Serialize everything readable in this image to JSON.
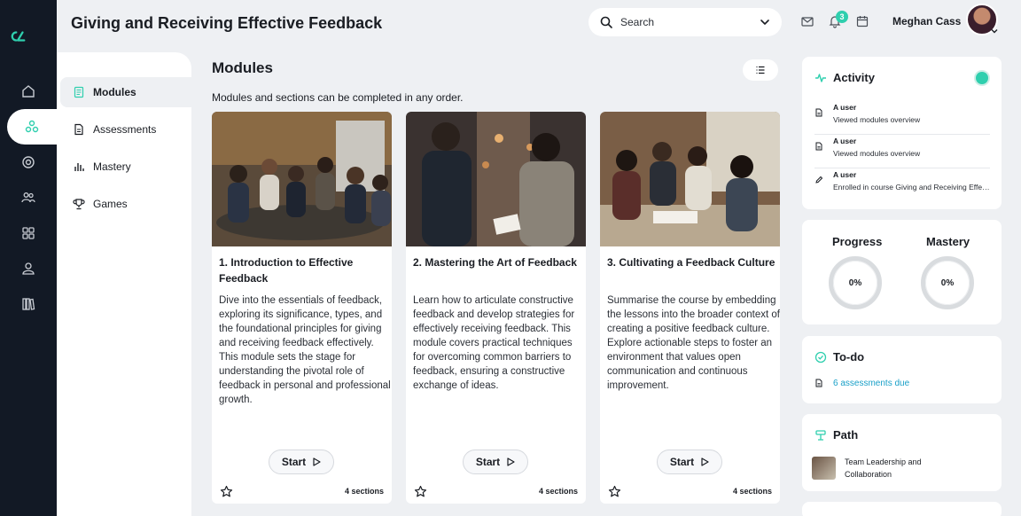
{
  "header": {
    "title": "Giving and Receiving Effective Feedback",
    "search_placeholder": "Search",
    "notifications_count": "3",
    "user_name": "Meghan Cass"
  },
  "rail": {
    "items": [
      "home-icon",
      "network-icon",
      "target-icon",
      "people-icon",
      "grid-icon",
      "user-icon",
      "library-icon"
    ],
    "active_index": 1,
    "brand_color": "#2fcfae"
  },
  "subnav": {
    "items": [
      {
        "label": "Modules",
        "icon": "book-icon"
      },
      {
        "label": "Assessments",
        "icon": "document-icon"
      },
      {
        "label": "Mastery",
        "icon": "bar-chart-icon"
      },
      {
        "label": "Games",
        "icon": "trophy-icon"
      }
    ]
  },
  "main": {
    "heading": "Modules",
    "subheading": "Modules and sections can be completed in any order.",
    "cards": [
      {
        "title": "1. Introduction to Effective Feedback",
        "description": "Dive into the essentials of feedback, exploring its significance, types, and the foundational principles for giving and receiving feedback effectively. This module sets the stage for understanding the pivotal role of feedback in personal and professional growth.",
        "button": "Start",
        "sections": "4 sections"
      },
      {
        "title": "2. Mastering the Art of Feedback",
        "description": "Learn how to articulate constructive feedback and develop strategies for effectively receiving feedback. This module covers practical techniques for overcoming common barriers to feedback, ensuring a constructive exchange of ideas.",
        "button": "Start",
        "sections": "4 sections"
      },
      {
        "title": "3. Cultivating a Feedback Culture",
        "description": "Summarise the course by embedding the lessons into the broader context of creating a positive feedback culture. Explore actionable steps to foster an environment that values open communication and continuous improvement.",
        "button": "Start",
        "sections": "4 sections"
      }
    ]
  },
  "activity": {
    "title": "Activity",
    "items": [
      {
        "user": "A user",
        "text": "Viewed modules overview"
      },
      {
        "user": "A user",
        "text": "Viewed modules overview"
      },
      {
        "user": "A user",
        "text": "Enrolled in course Giving and Receiving Effective Feedback"
      }
    ]
  },
  "stats": {
    "progress_label": "Progress",
    "progress_value": "0%",
    "mastery_label": "Mastery",
    "mastery_value": "0%"
  },
  "todo": {
    "title": "To-do",
    "item": "6 assessments due",
    "link_color": "#1aa0c8"
  },
  "path": {
    "title": "Path",
    "item": "Team Leadership and Collaboration"
  }
}
